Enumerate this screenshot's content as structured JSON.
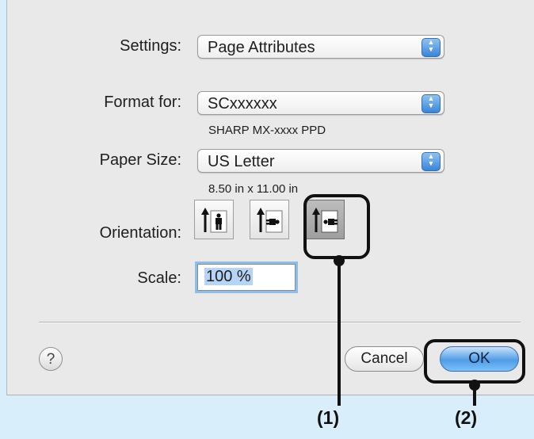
{
  "dialog": {
    "settings": {
      "label": "Settings:",
      "value": "Page Attributes"
    },
    "format_for": {
      "label": "Format for:",
      "value": "SCxxxxxx",
      "subtext": "SHARP MX-xxxx PPD"
    },
    "paper_size": {
      "label": "Paper Size:",
      "value": "US Letter",
      "subtext": "8.50 in x 11.00 in"
    },
    "orientation": {
      "label": "Orientation:",
      "options": [
        "portrait",
        "landscape-left",
        "landscape-right"
      ],
      "selected": "landscape-right"
    },
    "scale": {
      "label": "Scale:",
      "value": "100 %"
    },
    "help_label": "?",
    "cancel_label": "Cancel",
    "ok_label": "OK"
  },
  "annotations": {
    "callout_1": "(1)",
    "callout_2": "(2)"
  },
  "colors": {
    "background": "#d8eefa",
    "dialog": "#e9e9e9",
    "accent": "#4f9de8"
  }
}
